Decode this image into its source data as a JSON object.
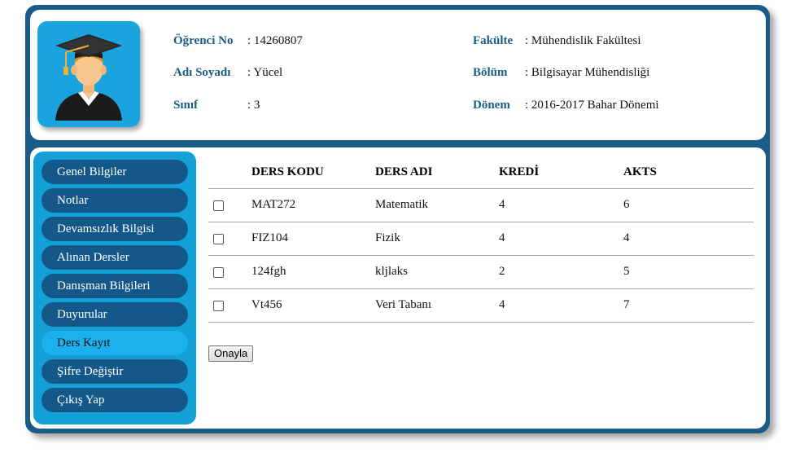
{
  "student": {
    "no_label": "Öğrenci No",
    "no_value": ": 14260807",
    "name_label": "Adı Soyadı",
    "name_value": ": Yücel",
    "class_label": "Sınıf",
    "class_value": ": 3",
    "faculty_label": "Fakülte",
    "faculty_value": ": Mühendislik Fakültesi",
    "department_label": "Bölüm",
    "department_value": ": Bilgisayar Mühendisliği",
    "term_label": "Dönem",
    "term_value": ": 2016-2017 Bahar Dönemi"
  },
  "avatar": {
    "icon": "graduate-icon"
  },
  "sidebar": {
    "items": [
      {
        "label": "Genel Bilgiler"
      },
      {
        "label": "Notlar"
      },
      {
        "label": "Devamsızlık Bilgisi"
      },
      {
        "label": "Alınan Dersler"
      },
      {
        "label": "Danışman Bilgileri"
      },
      {
        "label": "Duyurular"
      },
      {
        "label": "Ders Kayıt"
      },
      {
        "label": "Şifre Değiştir"
      },
      {
        "label": "Çıkış Yap"
      }
    ],
    "active_index": 6
  },
  "table": {
    "headers": [
      "DERS KODU",
      "DERS ADI",
      "KREDİ",
      "AKTS"
    ],
    "rows": [
      {
        "code": "MAT272",
        "name": "Matematik",
        "credit": "4",
        "akts": "6"
      },
      {
        "code": "FIZ104",
        "name": "Fizik",
        "credit": "4",
        "akts": "4"
      },
      {
        "code": "124fgh",
        "name": "kljlaks",
        "credit": "2",
        "akts": "5"
      },
      {
        "code": "Vt456",
        "name": "Veri Tabanı",
        "credit": "4",
        "akts": "7"
      }
    ]
  },
  "actions": {
    "confirm_label": "Onayla"
  },
  "colors": {
    "frame": "#1a5c87",
    "sidebar": "#12a0d6",
    "nav_item": "#14588a",
    "nav_active": "#1cb0ee"
  }
}
